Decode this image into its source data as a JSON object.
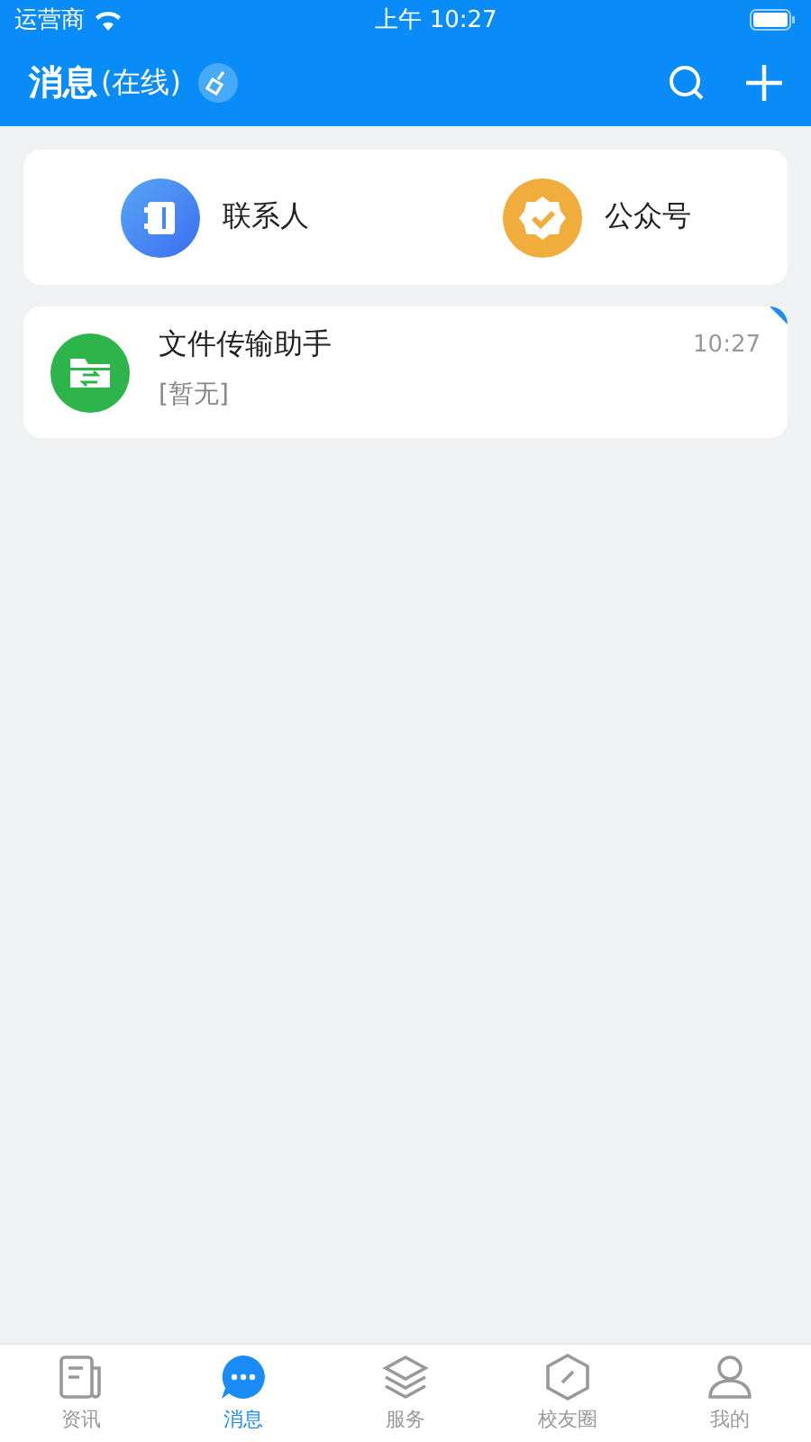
{
  "status_bar": {
    "carrier": "运营商",
    "time": "上午 10:27"
  },
  "header": {
    "title": "消息",
    "status": "(在线)"
  },
  "shortcuts": [
    {
      "kind": "contacts",
      "label": "联系人"
    },
    {
      "kind": "official",
      "label": "公众号"
    }
  ],
  "conversations": [
    {
      "kind": "file",
      "name": "文件传输助手",
      "preview": "[暂无]",
      "time": "10:27",
      "pinned": true
    }
  ],
  "tabs": [
    {
      "kind": "news",
      "label": "资讯",
      "selected": false
    },
    {
      "kind": "chat",
      "label": "消息",
      "selected": true
    },
    {
      "kind": "layers",
      "label": "服务",
      "selected": false
    },
    {
      "kind": "hex",
      "label": "校友圈",
      "selected": false
    },
    {
      "kind": "user",
      "label": "我的",
      "selected": false
    }
  ]
}
